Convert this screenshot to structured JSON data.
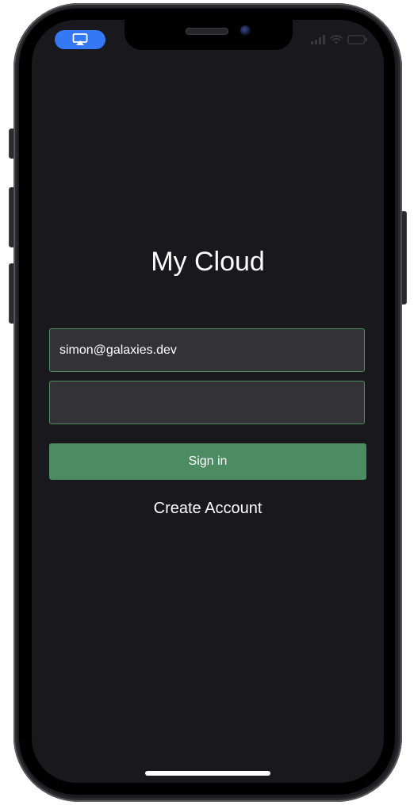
{
  "app": {
    "title": "My Cloud"
  },
  "status_bar": {
    "airplay_icon": "airplay-icon",
    "signal_icon": "cellular-signal-icon",
    "wifi_icon": "wifi-icon",
    "battery_icon": "battery-icon"
  },
  "login": {
    "email_value": "simon@galaxies.dev",
    "email_placeholder": "",
    "password_value": "",
    "password_placeholder": "",
    "sign_in_label": "Sign in",
    "create_account_label": "Create Account"
  },
  "colors": {
    "screen_background": "#19181c",
    "field_background": "#333335",
    "field_border": "#4c8c60",
    "primary_button": "#4d8c63",
    "airplay_pill": "#3478f6",
    "text": "#ffffff"
  }
}
